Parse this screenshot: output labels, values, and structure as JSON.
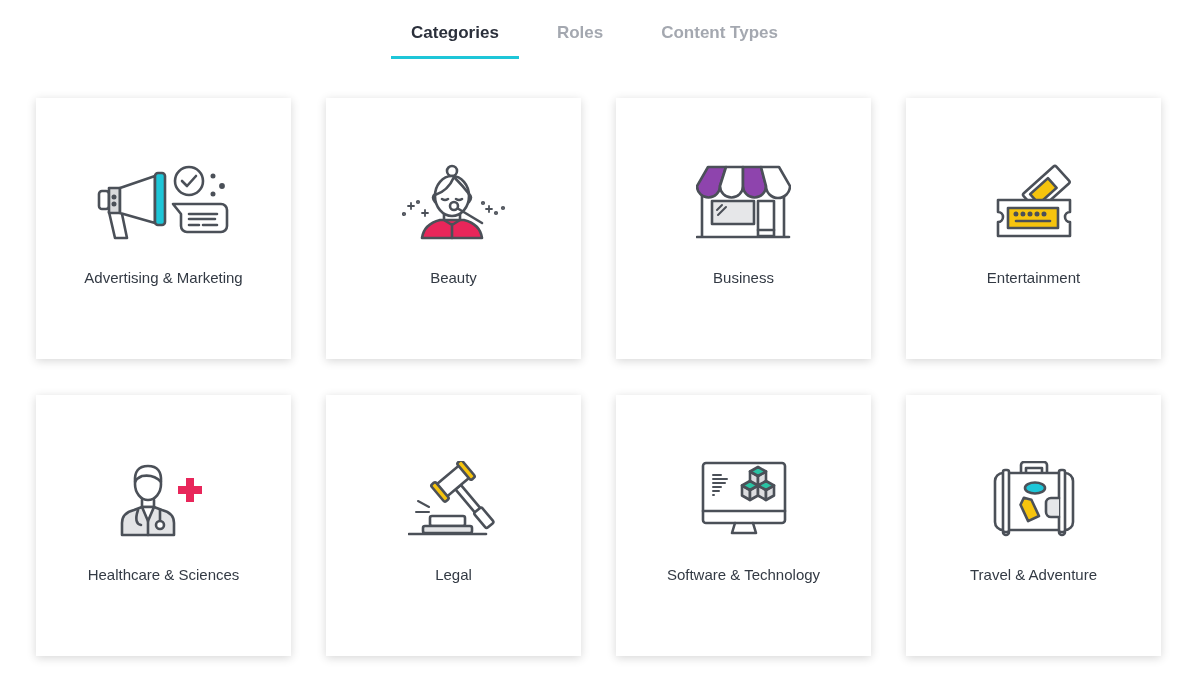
{
  "tabs": [
    {
      "label": "Categories",
      "selected": true
    },
    {
      "label": "Roles",
      "selected": false
    },
    {
      "label": "Content Types",
      "selected": false
    }
  ],
  "categories": [
    {
      "label": "Advertising & Marketing"
    },
    {
      "label": "Beauty"
    },
    {
      "label": "Business"
    },
    {
      "label": "Entertainment"
    },
    {
      "label": "Healthcare & Sciences"
    },
    {
      "label": "Legal"
    },
    {
      "label": "Software & Technology"
    },
    {
      "label": "Travel & Adventure"
    }
  ]
}
